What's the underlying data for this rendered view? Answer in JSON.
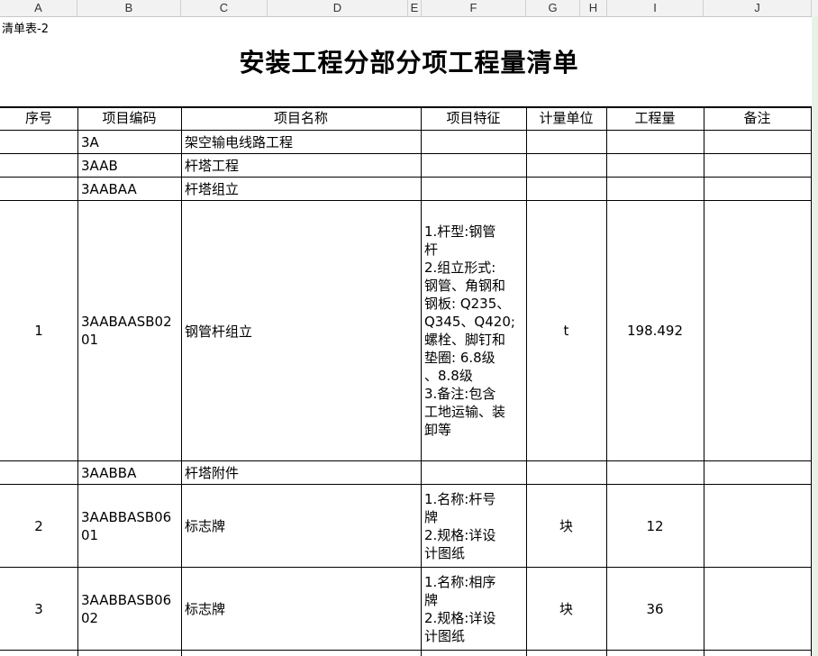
{
  "column_headers": [
    "A",
    "B",
    "C",
    "D",
    "E",
    "F",
    "G",
    "H",
    "I",
    "J"
  ],
  "sheet_label": "清单表-2",
  "title": "安装工程分部分项工程量清单",
  "table_headers": {
    "seq": "序号",
    "code": "项目编码",
    "name": "项目名称",
    "feature": "项目特征",
    "unit": "计量单位",
    "qty": "工程量",
    "note": "备注"
  },
  "rows": [
    {
      "seq": "",
      "code": "3A",
      "name": "架空输电线路工程",
      "feature": "",
      "unit": "",
      "qty": "",
      "note": ""
    },
    {
      "seq": "",
      "code": "3AAB",
      "name": "杆塔工程",
      "feature": "",
      "unit": "",
      "qty": "",
      "note": ""
    },
    {
      "seq": "",
      "code": "3AABAA",
      "name": "杆塔组立",
      "feature": "",
      "unit": "",
      "qty": "",
      "note": ""
    },
    {
      "seq": "1",
      "code": "3AABAASB0201",
      "name": "钢管杆组立",
      "feature": "1.杆型:钢管\n杆\n2.组立形式:\n钢管、角钢和\n钢板: Q235、\nQ345、Q420;\n螺栓、脚钉和\n垫圈: 6.8级\n、8.8级\n3.备注:包含\n工地运输、装\n卸等",
      "unit": "t",
      "qty": "198.492",
      "note": ""
    },
    {
      "seq": "",
      "code": "3AABBA",
      "name": "杆塔附件",
      "feature": "",
      "unit": "",
      "qty": "",
      "note": ""
    },
    {
      "seq": "2",
      "code": "3AABBASB0601",
      "name": "标志牌",
      "feature": "1.名称:杆号\n牌\n2.规格:详设\n计图纸",
      "unit": "块",
      "qty": "12",
      "note": ""
    },
    {
      "seq": "3",
      "code": "3AABBASB0602",
      "name": "标志牌",
      "feature": "1.名称:相序\n牌\n2.规格:详设\n计图纸",
      "unit": "块",
      "qty": "36",
      "note": ""
    }
  ]
}
